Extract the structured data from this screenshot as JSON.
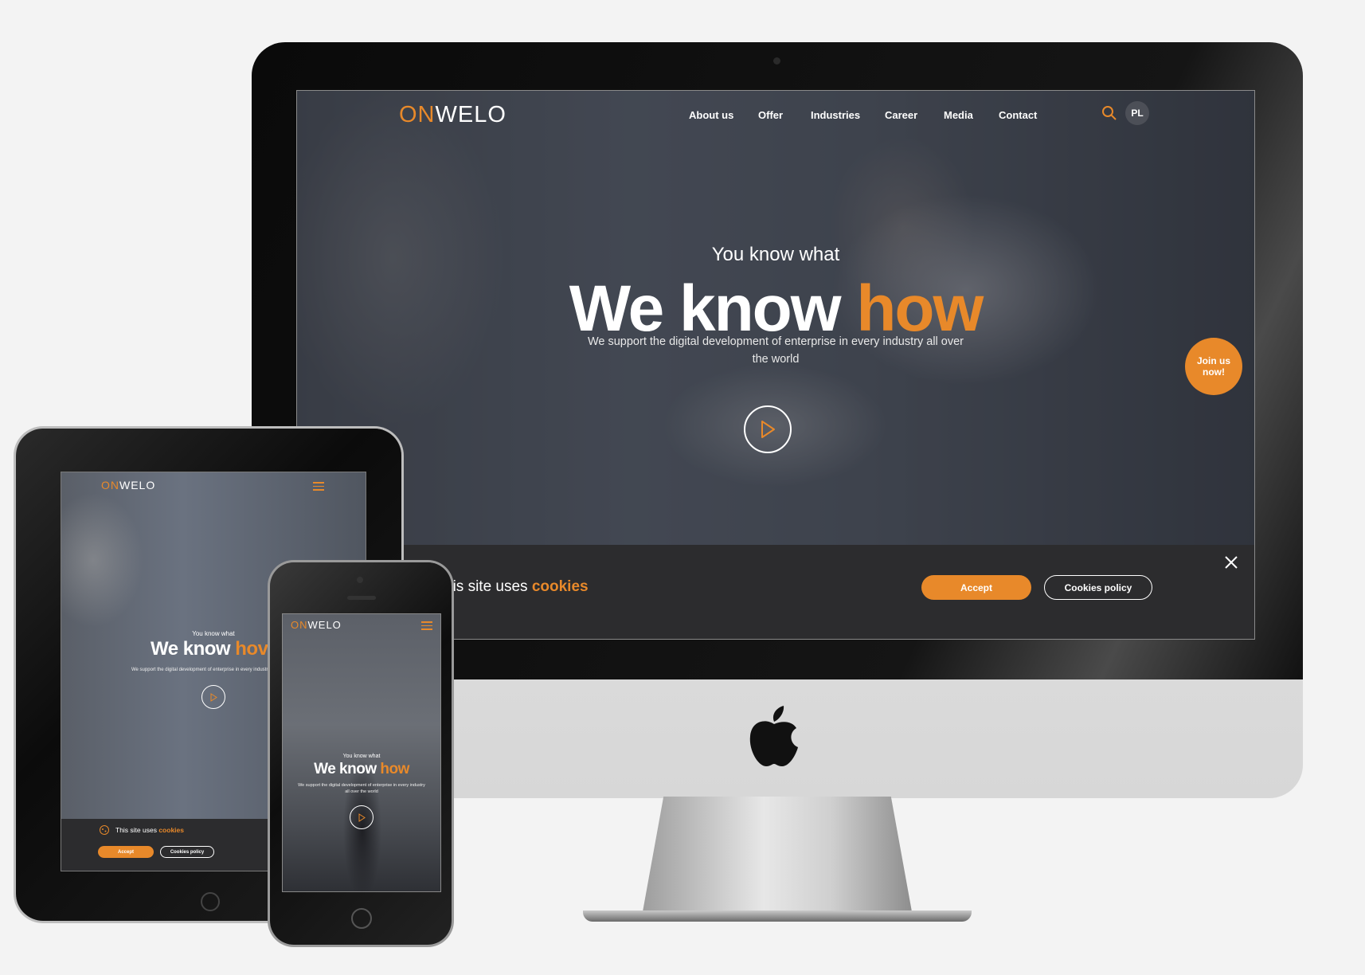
{
  "brand": {
    "logo_prefix": "ON",
    "logo_suffix": "WELO",
    "accent": "#e8892a",
    "dark": "#2c2c2e"
  },
  "desktop": {
    "nav": [
      "About us",
      "Offer",
      "Industries",
      "Career",
      "Media",
      "Contact"
    ],
    "lang": "PL",
    "hero": {
      "kicker": "You know what",
      "headline_white": "We know ",
      "headline_orange": "how",
      "sub": "We support the digital development of enterprise in every industry all over the world"
    },
    "join": "Join us now!",
    "cookies": {
      "text": "his site uses ",
      "link": "cookies",
      "accept": "Accept",
      "policy": "Cookies policy"
    }
  },
  "tablet": {
    "kicker": "You know what",
    "headline_white": "We know ",
    "headline_orange": "hov",
    "sub": "We support the digital development of enterprise in every industry all o",
    "cookies_text": "This site uses ",
    "cookies_link": "cookies",
    "accept": "Accept",
    "policy": "Cookies policy"
  },
  "phone": {
    "kicker": "You know what",
    "headline_white": "We know ",
    "headline_orange": "how",
    "sub": "We support the digital development of enterprise in every industry all over the world"
  },
  "icons": [
    "search-icon",
    "play-icon",
    "close-icon",
    "hamburger-icon",
    "cookie-icon",
    "apple-logo-icon"
  ]
}
